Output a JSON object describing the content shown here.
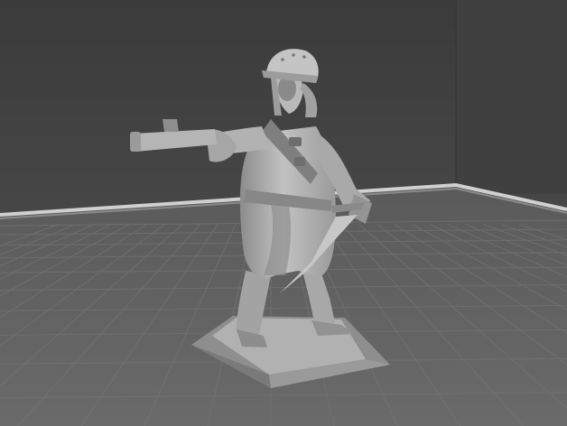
{
  "scene": {
    "subject": "miniature-soldier-figure",
    "colors": {
      "back_wall": "#434343",
      "floor": "#5f5f5f",
      "grid_line": "#6e6e6e",
      "wall_edge": "#d8d8d8",
      "model_light": "#bdbdbd",
      "model_mid": "#9a9a9a",
      "model_dark": "#6a6a6a",
      "base_top": "#a9a9a9",
      "base_side": "#8a8a8a"
    }
  }
}
